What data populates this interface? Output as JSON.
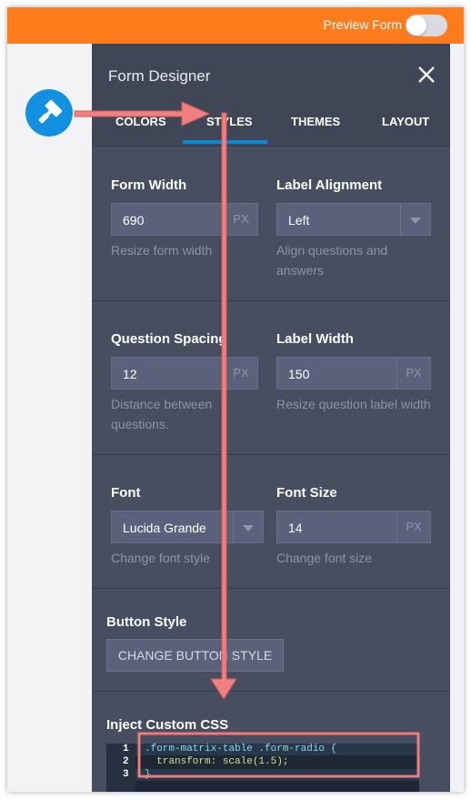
{
  "topbar": {
    "preview_label": "Preview Form",
    "accent": "#ff7b1c"
  },
  "panel": {
    "title": "Form Designer",
    "tabs": [
      "COLORS",
      "STYLES",
      "THEMES",
      "LAYOUT"
    ],
    "active_tab": "STYLES",
    "sections": {
      "form_width": {
        "label": "Form Width",
        "value": "690",
        "unit": "PX",
        "help": "Resize form width"
      },
      "label_alignment": {
        "label": "Label Alignment",
        "value": "Left",
        "help": "Align questions and answers"
      },
      "question_spacing": {
        "label": "Question Spacing",
        "value": "12",
        "unit": "PX",
        "help": "Distance between questions."
      },
      "label_width": {
        "label": "Label Width",
        "value": "150",
        "unit": "PX",
        "help": "Resize question label width"
      },
      "font": {
        "label": "Font",
        "value": "Lucida Grande",
        "help": "Change font style"
      },
      "font_size": {
        "label": "Font Size",
        "value": "14",
        "unit": "PX",
        "help": "Change font size"
      },
      "button_style": {
        "label": "Button Style",
        "button": "CHANGE BUTTON STYLE"
      },
      "custom_css": {
        "label": "Inject Custom CSS",
        "line_numbers": [
          "1",
          "2",
          "3"
        ],
        "lines": [
          ".form-matrix-table .form-radio {",
          "  transform: scale(1.5);",
          "}"
        ]
      }
    }
  },
  "icons": {
    "sidebar_tool": "paint-roller-icon",
    "close": "close-icon"
  },
  "annotation_color": "#f07b7b"
}
